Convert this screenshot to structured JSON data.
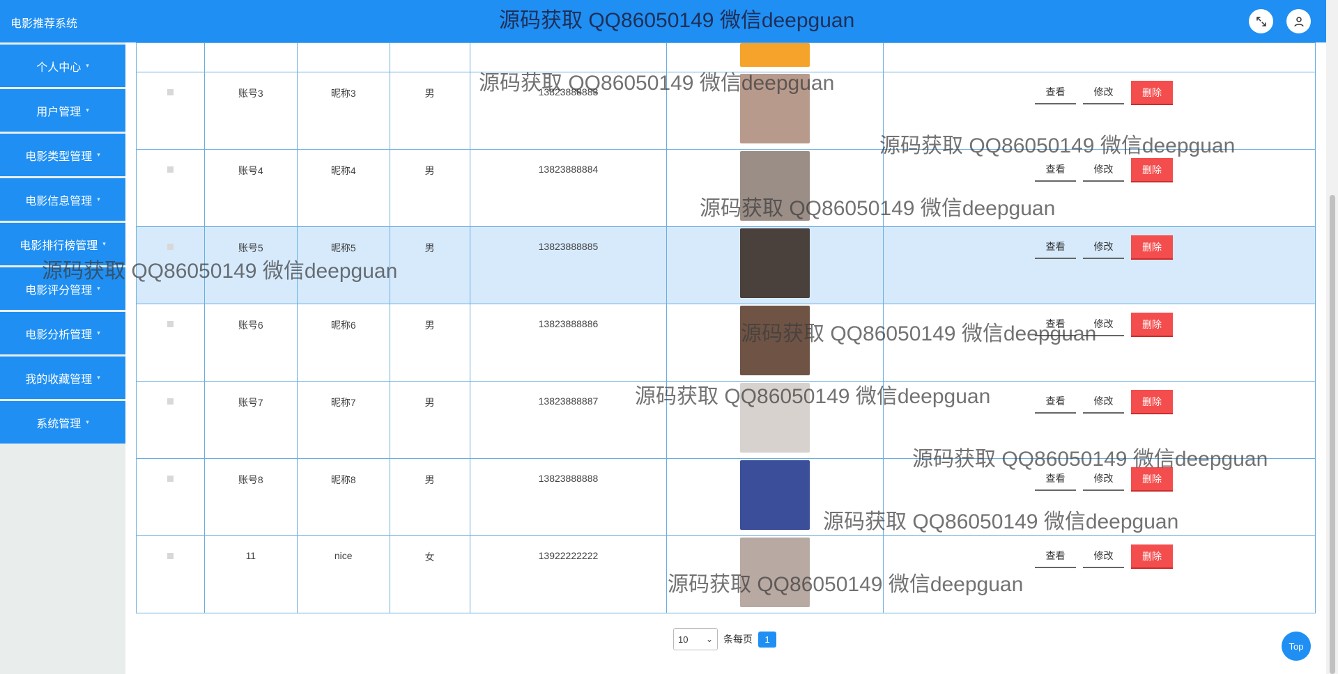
{
  "header": {
    "title": "电影推荐系统"
  },
  "sidebar": {
    "items": [
      {
        "label": "个人中心"
      },
      {
        "label": "用户管理"
      },
      {
        "label": "电影类型管理"
      },
      {
        "label": "电影信息管理"
      },
      {
        "label": "电影排行榜管理"
      },
      {
        "label": "电影评分管理"
      },
      {
        "label": "电影分析管理"
      },
      {
        "label": "我的收藏管理"
      },
      {
        "label": "系统管理"
      }
    ],
    "caret": "▾"
  },
  "table": {
    "rows": [
      {
        "account": "",
        "nickname": "",
        "gender": "",
        "phone": "",
        "photo_color": "#f5a32a",
        "partial": true
      },
      {
        "account": "账号3",
        "nickname": "昵称3",
        "gender": "男",
        "phone": "13823888883",
        "photo_color": "#b89a8c"
      },
      {
        "account": "账号4",
        "nickname": "昵称4",
        "gender": "男",
        "phone": "13823888884",
        "photo_color": "#9b8e87"
      },
      {
        "account": "账号5",
        "nickname": "昵称5",
        "gender": "男",
        "phone": "13823888885",
        "photo_color": "#4a403c",
        "selected": true
      },
      {
        "account": "账号6",
        "nickname": "昵称6",
        "gender": "男",
        "phone": "13823888886",
        "photo_color": "#6f5446"
      },
      {
        "account": "账号7",
        "nickname": "昵称7",
        "gender": "男",
        "phone": "13823888887",
        "photo_color": "#d8d2cf"
      },
      {
        "account": "账号8",
        "nickname": "昵称8",
        "gender": "男",
        "phone": "13823888888",
        "photo_color": "#3a4e9a"
      },
      {
        "account": "11",
        "nickname": "nice",
        "gender": "女",
        "phone": "13922222222",
        "photo_color": "#b8a9a2"
      }
    ],
    "actions": {
      "view": "查看",
      "edit": "修改",
      "delete": "删除"
    }
  },
  "pagination": {
    "page_size": "10",
    "per_page_label": "条每页",
    "current_page": "1"
  },
  "top_button": "Top",
  "watermark": "源码获取 QQ86050149 微信deepguan",
  "colors": {
    "primary": "#1f8ff3",
    "danger": "#f44d4d",
    "selected_row": "#d6eafc"
  }
}
